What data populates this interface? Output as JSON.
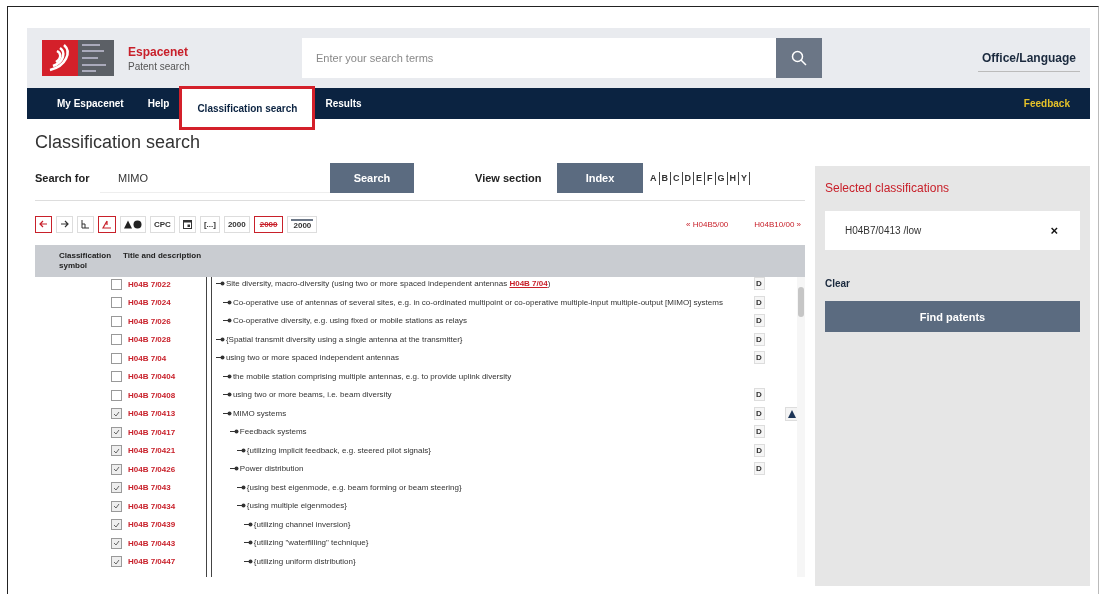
{
  "header": {
    "brand": "Espacenet",
    "subtitle": "Patent search",
    "search": {
      "placeholder": "Enter your search terms"
    },
    "office_language": "Office/Language"
  },
  "nav": {
    "tabs": [
      {
        "label": "My Espacenet",
        "selected": false,
        "highlighted": false
      },
      {
        "label": "Help",
        "selected": false,
        "highlighted": false
      },
      {
        "label": "Classification search",
        "selected": true,
        "highlighted": true
      },
      {
        "label": "Results",
        "selected": false,
        "highlighted": false
      }
    ],
    "feedback": "Feedback"
  },
  "page_title": "Classification search",
  "search": {
    "label": "Search for",
    "value": "MIMO",
    "button": "Search"
  },
  "view_section": {
    "label": "View section",
    "index_button": "Index",
    "letters": [
      "A",
      "B",
      "C",
      "D",
      "E",
      "F",
      "G",
      "H",
      "Y"
    ]
  },
  "toolbar": [
    {
      "kind": "back",
      "selected": true
    },
    {
      "kind": "forward",
      "selected": false
    },
    {
      "kind": "tree",
      "selected": false
    },
    {
      "kind": "hierarchy",
      "selected": true
    },
    {
      "kind": "warnings",
      "selected": false
    },
    {
      "kind": "text",
      "label": "CPC",
      "selected": false
    },
    {
      "kind": "calendar",
      "selected": false
    },
    {
      "kind": "text",
      "label": "[...]",
      "selected": false
    },
    {
      "kind": "year",
      "label": "2000",
      "selected": false
    },
    {
      "kind": "year-struck",
      "label": "2000",
      "selected": true
    },
    {
      "kind": "year-lined",
      "label": "2000",
      "selected": false
    }
  ],
  "pager": {
    "previous": "« H04B5/00",
    "next": "H04B10/00 »"
  },
  "table": {
    "columns": [
      "Classification symbol",
      "Title and description"
    ],
    "tree": [
      {
        "code": "H04B 7/022",
        "checked": false,
        "text": "Site diversity, macro-diversity (using two or more spaced independent antennas ",
        "link": "H04B 7/04",
        "tail": ")",
        "definition": "D",
        "children": [
          {
            "code": "H04B 7/024",
            "checked": false,
            "text": "Co-operative use of antennas of several sites, e.g. in co-ordinated multipoint or co-operative multiple-input multiple-output [MIMO] systems",
            "definition": "D"
          },
          {
            "code": "H04B 7/026",
            "checked": false,
            "text": "Co-operative diversity, e.g. using fixed or mobile stations as relays",
            "definition": "D"
          }
        ]
      },
      {
        "code": "H04B 7/028",
        "checked": false,
        "text": "{Spatial transmit diversity using a single antenna at the transmitter}",
        "definition": "D"
      },
      {
        "code": "H04B 7/04",
        "checked": false,
        "text": "using two or more spaced independent antennas",
        "definition": "D",
        "children": [
          {
            "code": "H04B 7/0404",
            "checked": false,
            "text": "the mobile station comprising multiple antennas, e.g. to provide uplink diversity"
          },
          {
            "code": "H04B 7/0408",
            "checked": false,
            "text": "using two or more beams, i.e. beam diversity",
            "definition": "D"
          },
          {
            "code": "H04B 7/0413",
            "checked": true,
            "text": "MIMO systems",
            "definition": "D",
            "flag": true,
            "children": [
              {
                "code": "H04B 7/0417",
                "checked": true,
                "text": "Feedback systems",
                "definition": "D",
                "children": [
                  {
                    "code": "H04B 7/0421",
                    "checked": true,
                    "text": "{utilizing implicit feedback, e.g. steered pilot signals}",
                    "definition": "D"
                  }
                ]
              },
              {
                "code": "H04B 7/0426",
                "checked": true,
                "text": "Power distribution",
                "definition": "D",
                "children": [
                  {
                    "code": "H04B 7/043",
                    "checked": true,
                    "text": "{using best eigenmode, e.g. beam forming or beam steering}"
                  },
                  {
                    "code": "H04B 7/0434",
                    "checked": true,
                    "text": "{using multiple eigenmodes}",
                    "children": [
                      {
                        "code": "H04B 7/0439",
                        "checked": true,
                        "text": "{utilizing channel inversion}"
                      },
                      {
                        "code": "H04B 7/0443",
                        "checked": true,
                        "text": "{utilizing \"waterfilling\" technique}"
                      },
                      {
                        "code": "H04B 7/0447",
                        "checked": true,
                        "text": "{utilizing uniform distribution}"
                      }
                    ]
                  }
                ]
              }
            ]
          }
        ]
      }
    ]
  },
  "selected_panel": {
    "title": "Selected classifications",
    "items": [
      {
        "label": "H04B7/0413 /low",
        "remove": "×"
      }
    ],
    "clear": "Clear",
    "find_button": "Find patents"
  }
}
